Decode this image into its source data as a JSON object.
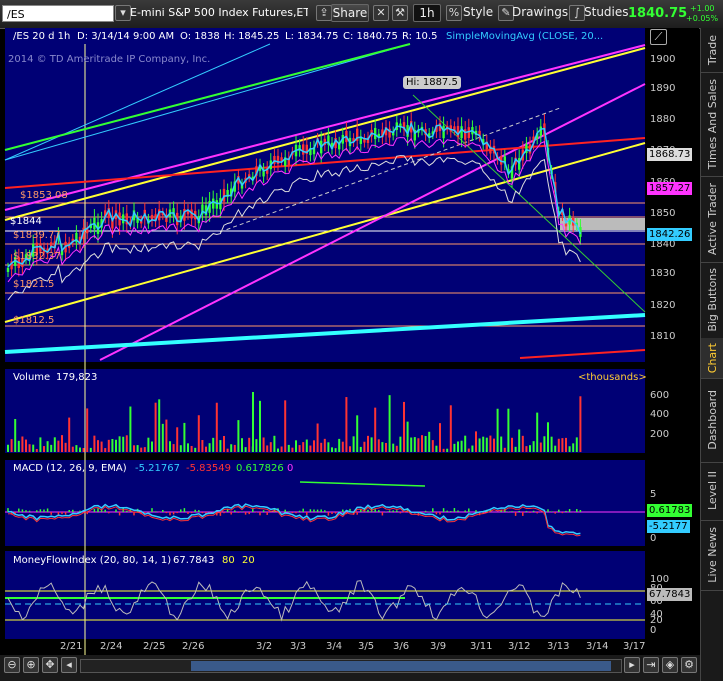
{
  "toolbar": {
    "symbol": "/ES",
    "description": "E-mini S&P 500 Index Futures,ET...",
    "share_label": "Share",
    "timeframe": "1h",
    "style_label": "Style",
    "drawings_label": "Drawings",
    "studies_label": "Studies",
    "last_price": "1840.75",
    "change_abs": "+1.00",
    "change_pct": "+0.05%"
  },
  "info_bar": {
    "symbol_period": "/ES 20 d 1h",
    "date": "D: 3/14/14 9:00 AM",
    "open": "O: 1838",
    "high": "H: 1845.25",
    "low": "L: 1834.75",
    "close": "C: 1840.75",
    "range": "R: 10.5",
    "study": "SimpleMovingAvg (CLOSE, 20..."
  },
  "watermark": "2014 © TD Ameritrade IP Company, Inc.",
  "price_chart": {
    "hi_label": "Hi: 1887.5",
    "level_labels": [
      "$1853.08",
      "$1844",
      "$1839.77",
      "$1832.37",
      "$1821.5",
      "$1812.5"
    ],
    "axis_ticks": [
      "1900",
      "1890",
      "1880",
      "1870",
      "1860",
      "1850",
      "1840",
      "1830",
      "1820",
      "1810"
    ],
    "price_tags": [
      "1868.73",
      "1857.27",
      "1842.26"
    ],
    "price_tag_colors": [
      "#dddddd",
      "#ff33ff",
      "#33ccff"
    ]
  },
  "volume_panel": {
    "title": "Volume",
    "value": "179,823",
    "units": "<thousands>",
    "axis_ticks": [
      "600",
      "400",
      "200"
    ]
  },
  "macd_panel": {
    "title": "MACD (12, 26, 9, EMA)",
    "value": "-5.21767",
    "avg": "-5.83549",
    "diff": "0.617826",
    "zero": "0",
    "axis_ticks": [
      "5",
      "0"
    ],
    "tag_diff": "0.61783",
    "tag_value": "-5.2177"
  },
  "mfi_panel": {
    "title": "MoneyFlowIndex (20, 80, 14, 1)",
    "value": "67.7843",
    "overbought": "80",
    "oversold": "20",
    "axis_ticks": [
      "100",
      "80",
      "60",
      "40",
      "20",
      "0"
    ],
    "tag_value": "67.7843"
  },
  "x_axis": [
    "2/21",
    "2/24",
    "2/25",
    "2/26",
    "3/2",
    "3/3",
    "3/4",
    "3/5",
    "3/6",
    "3/9",
    "3/11",
    "3/12",
    "3/13",
    "3/14",
    "3/17"
  ],
  "side_tabs": [
    "Trade",
    "Times And Sales",
    "Active Trader",
    "Big Buttons",
    "Chart",
    "Dashboard",
    "Level II",
    "Live News"
  ],
  "active_side_tab": "Chart",
  "colors": {
    "panel_bg": "#000075",
    "price_green": "#33ff33",
    "up_candle": "#33ff33",
    "down_candle": "#ff3333",
    "regression_yellow": "#ffff33",
    "regression_magenta": "#ff33ff",
    "trend_cyan": "#33ffff"
  }
}
